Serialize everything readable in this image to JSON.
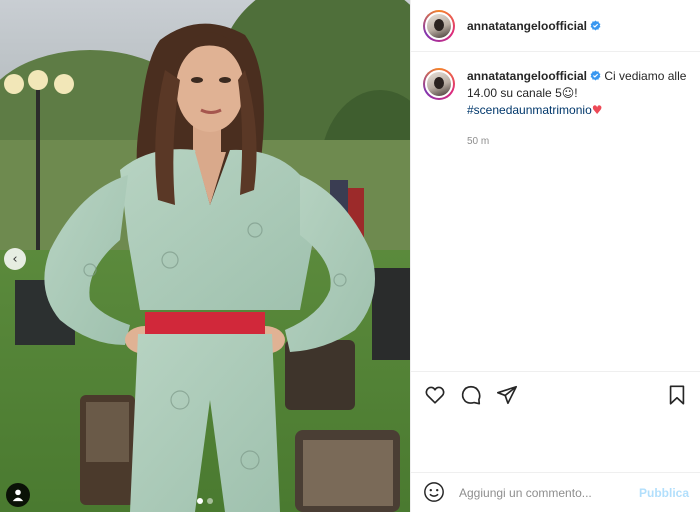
{
  "post": {
    "username": "annatatangeloofficial",
    "verified": true,
    "caption_text": "Ci vediamo alle 14.00 su canale 5",
    "caption_emoji": "☺",
    "caption_end": "!",
    "hashtag": "#scenedaunmatrimonio",
    "heart": "♥",
    "time_ago": "50 m"
  },
  "media": {
    "prev_arrow": "‹",
    "carousel_count": 2,
    "carousel_active": 0
  },
  "actions": {
    "icons": [
      "heart-icon",
      "comment-icon",
      "share-icon",
      "bookmark-icon"
    ]
  },
  "add_comment": {
    "placeholder": "Aggiungi un commento...",
    "publish_label": "Pubblica"
  },
  "colors": {
    "link": "#00376b",
    "verified": "#3897f0",
    "publish_disabled": "#b2dffc",
    "heart": "#ed4956"
  }
}
